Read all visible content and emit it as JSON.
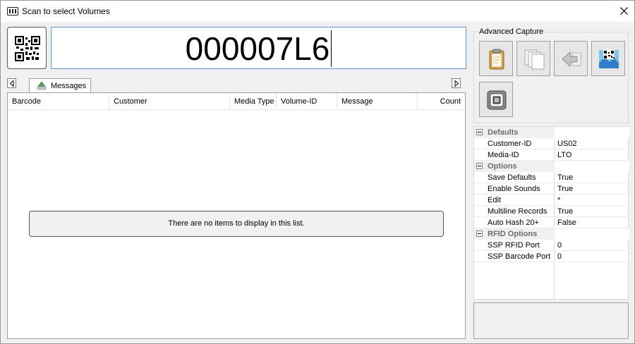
{
  "window": {
    "title": "Scan to select Volumes",
    "icon": "barcode-icon",
    "close_icon": "close-icon"
  },
  "scan": {
    "value": "000007L6"
  },
  "tabs": [
    {
      "label": "Messages",
      "icon": "messages-icon",
      "active": true
    }
  ],
  "list": {
    "columns": [
      "Barcode",
      "Customer",
      "Media Type",
      "Volume-ID",
      "Message",
      "Count"
    ],
    "empty_message": "There are no items to display in this list."
  },
  "advanced_capture": {
    "title": "Advanced Capture",
    "buttons": [
      "clipboard-icon",
      "pages-icon",
      "back-arrow-icon",
      "qr-image-icon",
      "rfid-chip-icon"
    ]
  },
  "properties": {
    "categories": [
      {
        "name": "Defaults",
        "items": [
          {
            "name": "Customer-ID",
            "value": "US02"
          },
          {
            "name": "Media-ID",
            "value": "LTO"
          }
        ]
      },
      {
        "name": "Options",
        "items": [
          {
            "name": "Save Defaults",
            "value": "True"
          },
          {
            "name": "Enable Sounds",
            "value": "True"
          },
          {
            "name": "Edit",
            "value": "*"
          },
          {
            "name": "Multiline Records",
            "value": "True"
          },
          {
            "name": "Auto Hash 20+",
            "value": "False"
          }
        ]
      },
      {
        "name": "RFID Options",
        "items": [
          {
            "name": "SSP RFID Port",
            "value": "0"
          },
          {
            "name": "SSP Barcode Port",
            "value": "0"
          }
        ]
      }
    ]
  },
  "colors": {
    "input_focus_border": "#5d9ad8",
    "window_bg": "#f0f0f0",
    "category_text": "#6d6d6d"
  }
}
